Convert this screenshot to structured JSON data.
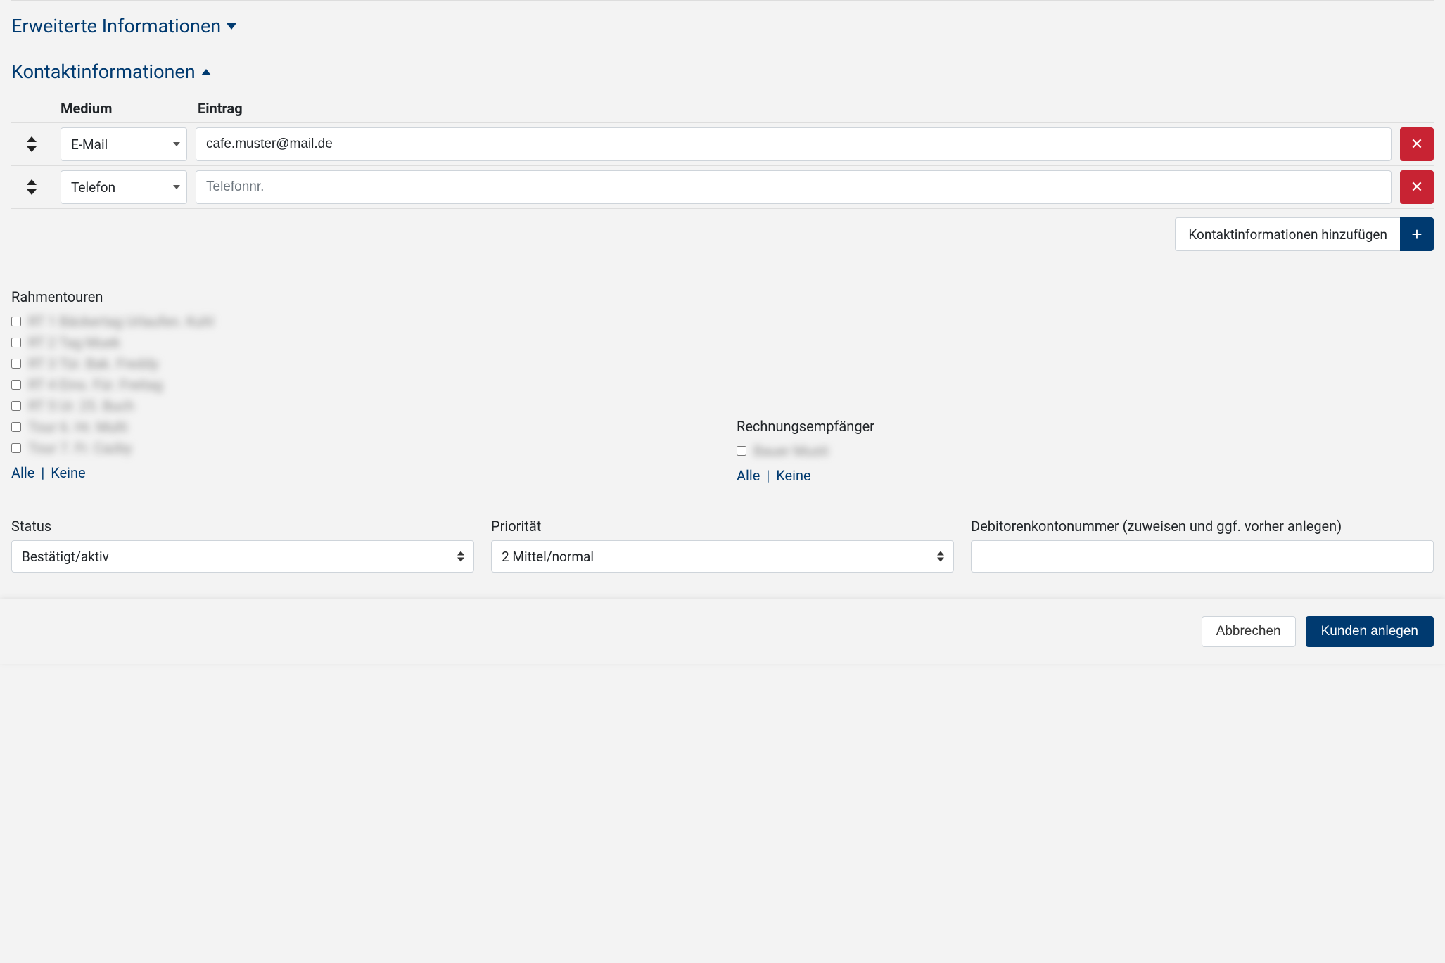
{
  "sections": {
    "extended": {
      "title": "Erweiterte Informationen"
    },
    "contact": {
      "title": "Kontaktinformationen",
      "header_medium": "Medium",
      "header_entry": "Eintrag",
      "rows": [
        {
          "medium": "E-Mail",
          "value": "cafe.muster@mail.de",
          "placeholder": ""
        },
        {
          "medium": "Telefon",
          "value": "",
          "placeholder": "Telefonnr."
        }
      ],
      "add_label": "Kontaktinformationen hinzufügen"
    }
  },
  "tours": {
    "label": "Rahmentouren",
    "items": [
      {
        "text": "RT 1 Bäckertag Urlaufen. Kuhl"
      },
      {
        "text": "RT 2 Tag Muek"
      },
      {
        "text": "RT 3 Tür. Bak. Freddy"
      },
      {
        "text": "RT 4 Eins. Für. Freitag"
      },
      {
        "text": "RT 5 Ur. 25. Buch"
      },
      {
        "text": "Tour 6. Hr. Multi"
      },
      {
        "text": "Tour 7. Fr. Cazby"
      }
    ],
    "select_all": "Alle",
    "select_none": "Keine"
  },
  "invoice_recipient": {
    "label": "Rechnungsempfänger",
    "items": [
      {
        "text": "Bauer Musti"
      }
    ],
    "select_all": "Alle",
    "select_none": "Keine"
  },
  "status": {
    "label": "Status",
    "value": "Bestätigt/aktiv"
  },
  "priority": {
    "label": "Priorität",
    "value": "2 Mittel/normal"
  },
  "debitor": {
    "label": "Debitorenkontonummer (zuweisen und ggf. vorher anlegen)",
    "value": ""
  },
  "footer": {
    "cancel": "Abbrechen",
    "submit": "Kunden anlegen"
  }
}
